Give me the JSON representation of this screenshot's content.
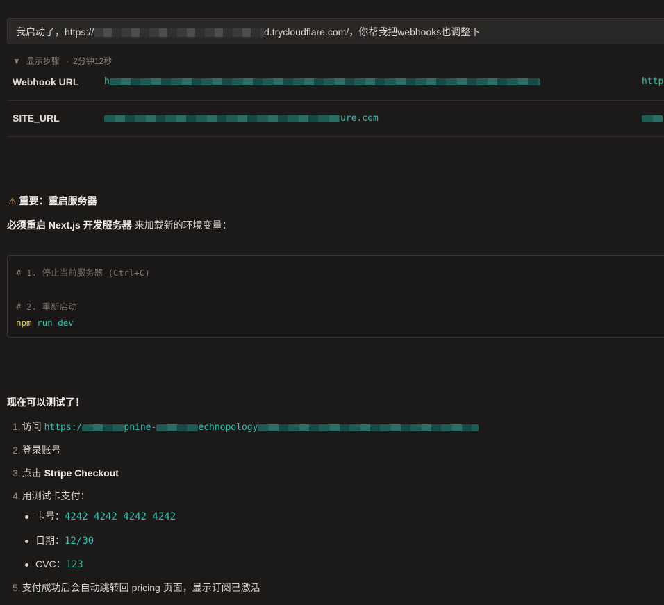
{
  "user_message": {
    "prefix": "我启动了，https://",
    "suffix": "d.trycloudflare.com/，你帮我把webhooks也调整下"
  },
  "steps": {
    "arrow": "▼",
    "label": "显示步骤",
    "sep": "·",
    "duration": "2分钟12秒"
  },
  "env_table": {
    "rows": [
      {
        "key": "Webhook URL",
        "value_visible": "h",
        "extra": "http"
      },
      {
        "key": "SITE_URL",
        "value_suffix": "ure.com"
      }
    ]
  },
  "warning": {
    "icon": "warning-icon",
    "title": "重要：重启服务器"
  },
  "restart_note": {
    "bold": "必须重启 Next.js 开发服务器",
    "rest": " 来加载新的环境变量："
  },
  "code": {
    "line1": "# 1. 停止当前服务器 (Ctrl+C)",
    "line2": "# 2. 重新启动",
    "cmd": "npm",
    "args": "run dev"
  },
  "testing": {
    "title": "现在可以测试了！",
    "items": [
      {
        "num": "1.",
        "text": "访问 ",
        "link": "https:/",
        "link_mid": "pnine-",
        "link_mid2": "echnopology"
      },
      {
        "num": "2.",
        "text": "登录账号"
      },
      {
        "num": "3.",
        "text": "点击 ",
        "bold": "Stripe Checkout"
      },
      {
        "num": "4.",
        "text": "用测试卡支付："
      },
      {
        "num": "5.",
        "text": "支付成功后会自动跳转回 pricing 页面，显示订阅已激活"
      }
    ],
    "card": [
      {
        "label": "卡号：",
        "value": "4242 4242 4242 4242"
      },
      {
        "label": "日期：",
        "value": "12/30"
      },
      {
        "label": "CVC：",
        "value": "123"
      }
    ]
  },
  "colors": {
    "background": "#1c1919",
    "accent_teal": "#2bc4b0",
    "warning": "#f0a93a"
  }
}
